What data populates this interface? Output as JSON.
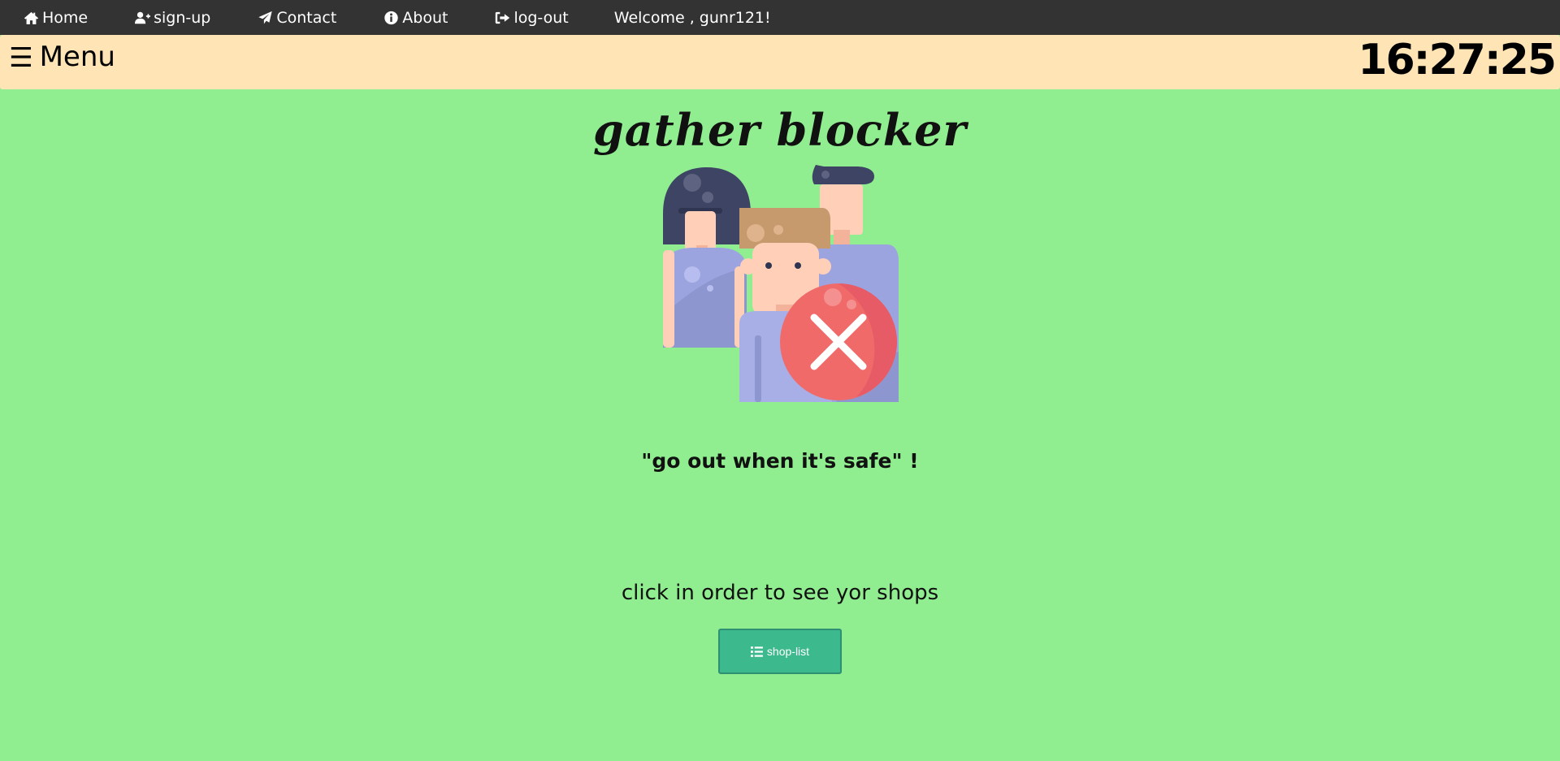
{
  "nav": {
    "items": [
      {
        "label": "Home",
        "icon": "home-icon"
      },
      {
        "label": "sign-up",
        "icon": "user-plus-icon"
      },
      {
        "label": "Contact",
        "icon": "paper-plane-icon"
      },
      {
        "label": "About",
        "icon": "info-circle-icon"
      },
      {
        "label": "log-out",
        "icon": "sign-out-icon"
      }
    ],
    "welcome": "Welcome , gunr121!"
  },
  "menubar": {
    "menu_icon": "☰",
    "menu_label": "Menu",
    "clock": "16:27:25"
  },
  "main": {
    "title": "gather blocker",
    "logo_icon": "crowd-blocked-icon",
    "slogan": "\"go out when it's safe\" !",
    "instruction": "click in order to see yor shops",
    "shop_button_label": "shop-list",
    "shop_button_icon": "list-icon"
  },
  "colors": {
    "page_background": "#90ee90",
    "nav_background": "#333333",
    "menubar_background": "#ffe4b5",
    "button_background": "#3cb98d"
  }
}
